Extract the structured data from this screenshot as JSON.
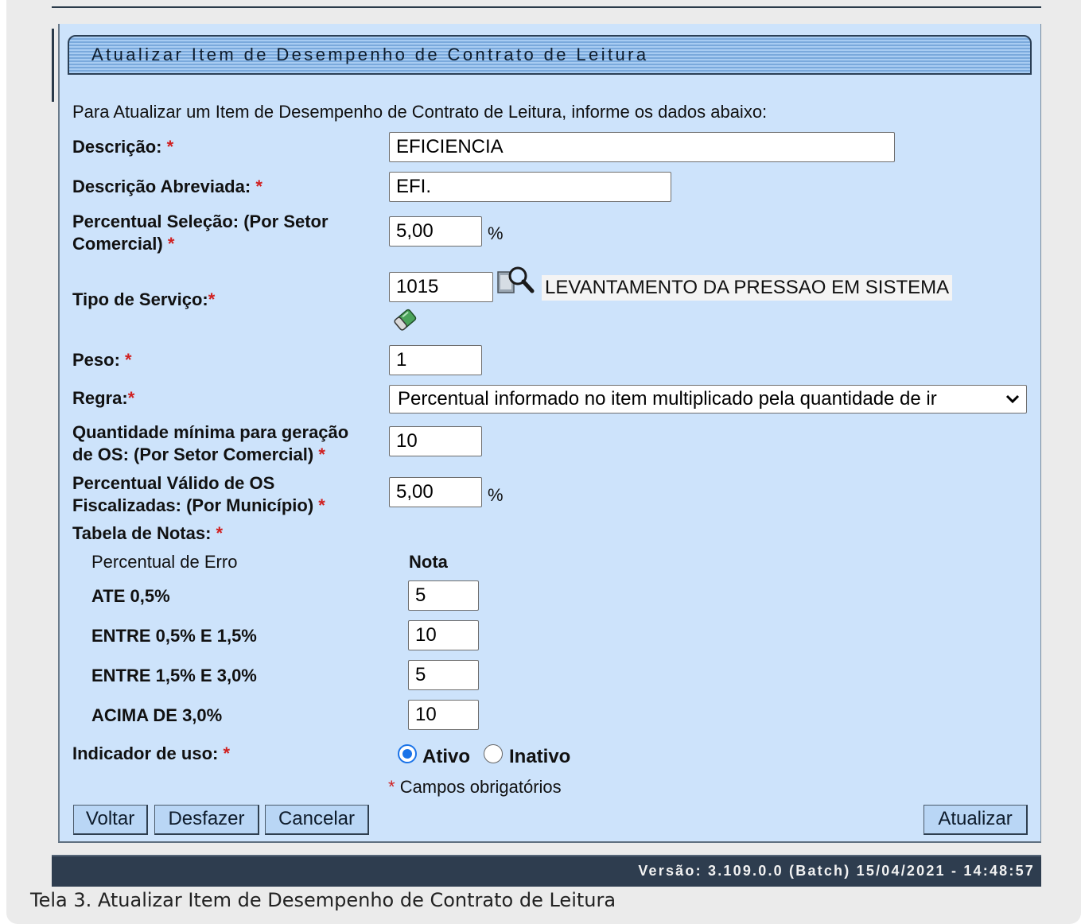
{
  "title": "Atualizar Item de Desempenho de Contrato de Leitura",
  "intro": "Para Atualizar um Item de Desempenho de Contrato de Leitura, informe os dados abaixo:",
  "fields": {
    "descricao": {
      "label": "Descrição:",
      "value": "EFICIENCIA"
    },
    "descricao_abreviada": {
      "label": "Descrição Abreviada:",
      "value": "EFI."
    },
    "percentual_selecao": {
      "label_line1": "Percentual Seleção: (Por Setor",
      "label_line2": "Comercial)",
      "value": "5,00",
      "unit": "%"
    },
    "tipo_servico": {
      "label": "Tipo de Serviço:",
      "value": "1015",
      "name": "LEVANTAMENTO DA PRESSAO EM SISTEMA"
    },
    "peso": {
      "label": "Peso:",
      "value": "1"
    },
    "regra": {
      "label": "Regra:",
      "selected": "Percentual informado no item multiplicado pela quantidade de ir"
    },
    "quantidade_minima": {
      "label_line1": "Quantidade mínima para geração",
      "label_line2": "de OS: (Por Setor Comercial)",
      "value": "10"
    },
    "percentual_valido": {
      "label_line1": "Percentual Válido de OS",
      "label_line2": "Fiscalizadas: (Por Município)",
      "value": "5,00",
      "unit": "%"
    }
  },
  "tabela_notas": {
    "label": "Tabela de Notas:",
    "col_percentual": "Percentual de Erro",
    "col_nota": "Nota",
    "rows": [
      {
        "faixa": "ATE 0,5%",
        "nota": "5"
      },
      {
        "faixa": "ENTRE 0,5% E 1,5%",
        "nota": "10"
      },
      {
        "faixa": "ENTRE 1,5% E 3,0%",
        "nota": "5"
      },
      {
        "faixa": "ACIMA DE 3,0%",
        "nota": "10"
      }
    ]
  },
  "indicador_uso": {
    "label": "Indicador de uso:",
    "option_ativo": "Ativo",
    "option_inativo": "Inativo",
    "selected": "Ativo"
  },
  "required_marker": "*",
  "required_note": "Campos obrigatórios",
  "buttons": {
    "voltar": "Voltar",
    "desfazer": "Desfazer",
    "cancelar": "Cancelar",
    "atualizar": "Atualizar"
  },
  "footer": "Versão: 3.109.0.0 (Batch) 15/04/2021 - 14:48:57",
  "caption": "Tela 3. Atualizar Item de Desempenho de Contrato de Leitura",
  "icons": {
    "search": "magnifier-search-icon",
    "clear": "eraser-icon"
  },
  "colors": {
    "panel_bg": "#cde3fb",
    "required": "#d02020",
    "button_bg": "#b9d6f5",
    "footer_bg": "#2e3d4f"
  }
}
